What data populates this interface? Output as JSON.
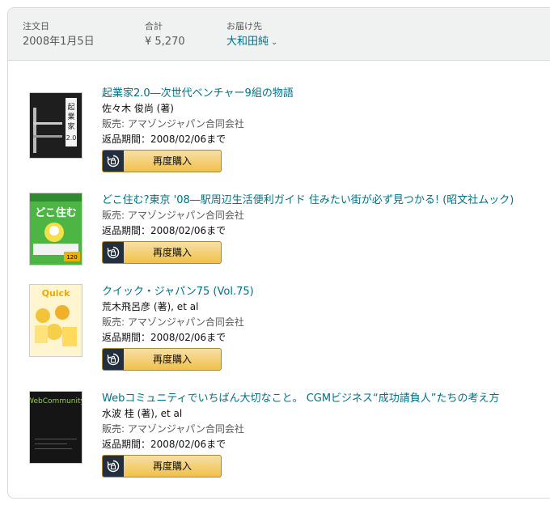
{
  "order": {
    "date_label": "注文日",
    "date": "2008年1月5日",
    "total_label": "合計",
    "total": "¥ 5,270",
    "ship_label": "お届け先",
    "ship_to": "大和田純"
  },
  "items": [
    {
      "title": "起業家2.0―次世代ベンチャー9組の物語",
      "author": "佐々木 俊尚 (著)",
      "seller": "販売: アマゾンジャパン合同会社",
      "return": "返品期間：2008/02/06まで",
      "rebuy": "再度購入",
      "cover_text": "起業家2.0"
    },
    {
      "title": "どこ住む?東京 '08―駅周辺生活便利ガイド 住みたい街が必ず見つかる! (昭文社ムック)",
      "seller": "販売: アマゾンジャパン合同会社",
      "return": "返品期間：2008/02/06まで",
      "rebuy": "再度購入",
      "cover_text": "どこ住む?"
    },
    {
      "title": "クイック・ジャパン75 (Vol.75)",
      "author": "荒木飛呂彦 (著), et al",
      "seller": "販売: アマゾンジャパン合同会社",
      "return": "返品期間：2008/02/06まで",
      "rebuy": "再度購入",
      "cover_text": "Quick Japan"
    },
    {
      "title": "Webコミュニティでいちばん大切なこと。 CGMビジネス“成功請負人”たちの考え方",
      "author": "水波 桂 (著), et al",
      "seller": "販売: アマゾンジャパン合同会社",
      "return": "返品期間：2008/02/06まで",
      "rebuy": "再度購入",
      "cover_text": "Web Community"
    }
  ],
  "colors": {
    "link": "#007185",
    "button_top": "#f7dfa5",
    "button_bottom": "#f0c14b",
    "header_bg": "#f0f2f2"
  }
}
